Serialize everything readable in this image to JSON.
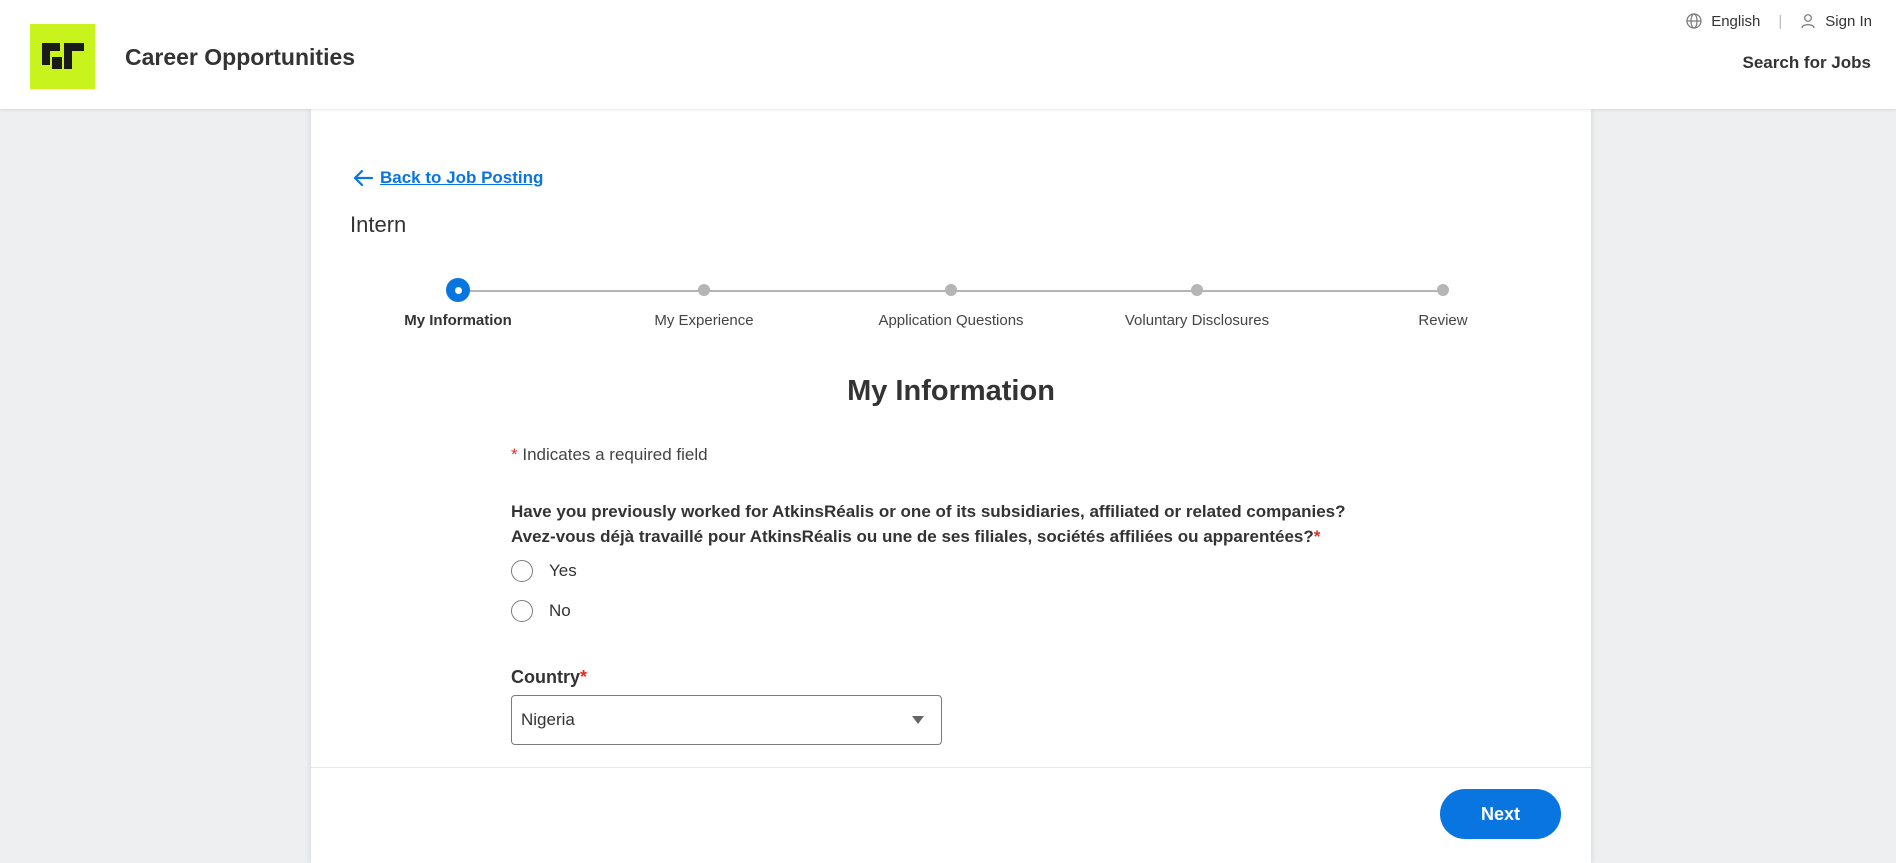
{
  "header": {
    "site_title": "Career Opportunities",
    "language_label": "English",
    "sign_in_label": "Sign In",
    "search_jobs_label": "Search for Jobs"
  },
  "job": {
    "back_link": "Back to Job Posting",
    "title": "Intern"
  },
  "progress": {
    "steps": [
      {
        "label": "My Information",
        "active": true
      },
      {
        "label": "My Experience",
        "active": false
      },
      {
        "label": "Application Questions",
        "active": false
      },
      {
        "label": "Voluntary Disclosures",
        "active": false
      },
      {
        "label": "Review",
        "active": false
      }
    ]
  },
  "form": {
    "section_title": "My Information",
    "required_star": "*",
    "required_note": "Indicates a required field",
    "question_line1": "Have you previously worked for AtkinsRéalis or one of its subsidiaries, affiliated or related companies?",
    "question_line2": "Avez-vous déjà travaillé pour AtkinsRéalis ou une de ses filiales, sociétés affiliées ou apparentées?",
    "options": [
      "Yes",
      "No"
    ],
    "country_label": "Country",
    "country_value": "Nigeria",
    "next_label": "Next"
  },
  "colors": {
    "accent": "#0875e1",
    "logo_bg": "#c8f31d",
    "required": "#de2e21"
  },
  "icons": {
    "language": "globe-icon",
    "sign_in": "user-icon",
    "back": "arrow-left-icon",
    "select": "caret-down-icon"
  }
}
